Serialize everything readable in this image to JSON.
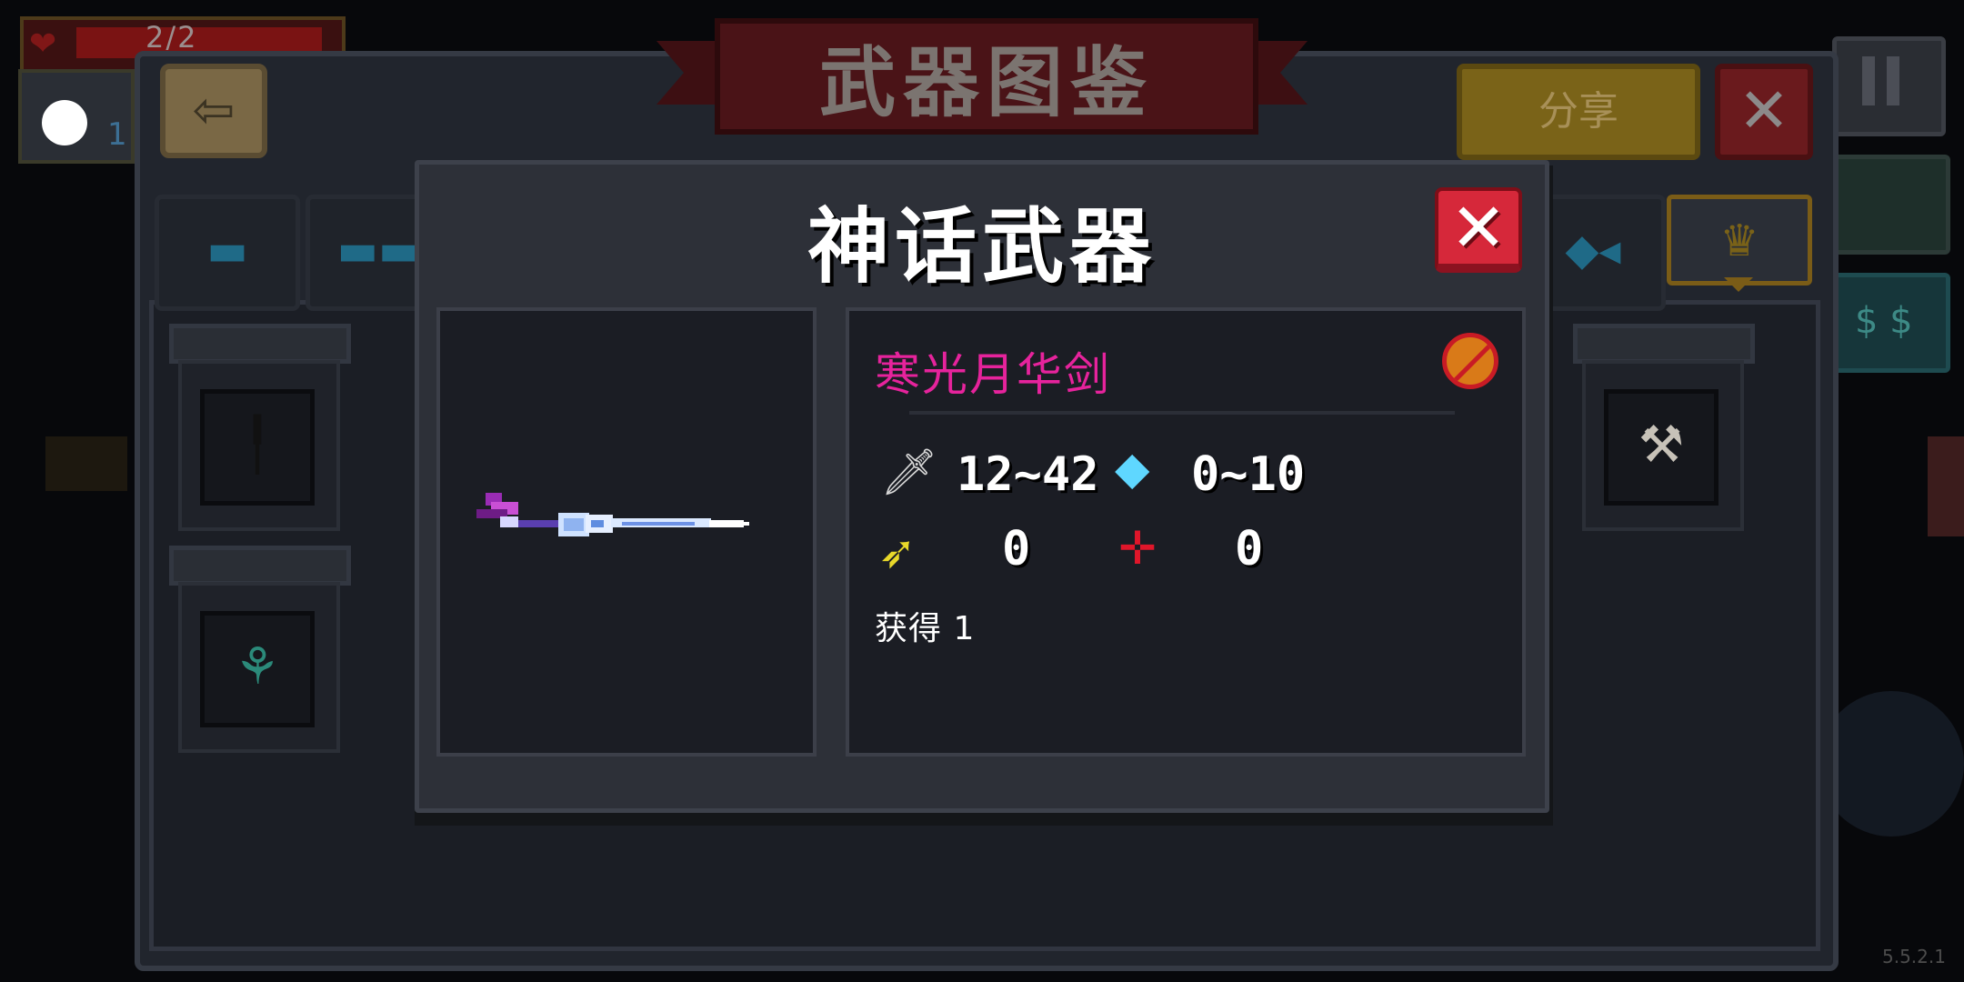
{
  "hud": {
    "hp_text": "2/2",
    "energy_text": "1"
  },
  "codex": {
    "title": "武器图鉴",
    "share_label": "分享",
    "close_glyph": "✕",
    "back_glyph": "⇦",
    "tabs": [
      {
        "icon": "pistol-icon"
      },
      {
        "icon": "rifle-icon"
      },
      {
        "icon": "fish-icon"
      },
      {
        "icon": "crown-icon",
        "active": true
      }
    ]
  },
  "modal": {
    "title": "神话武器",
    "close_glyph": "✕",
    "weapon": {
      "name": "寒光月华剑",
      "name_color": "#e6239c",
      "damage": "12~42",
      "energy": "0~10",
      "crit": "0",
      "accuracy": "0",
      "acquired": "获得 1"
    }
  },
  "version": "5.5.2.1"
}
